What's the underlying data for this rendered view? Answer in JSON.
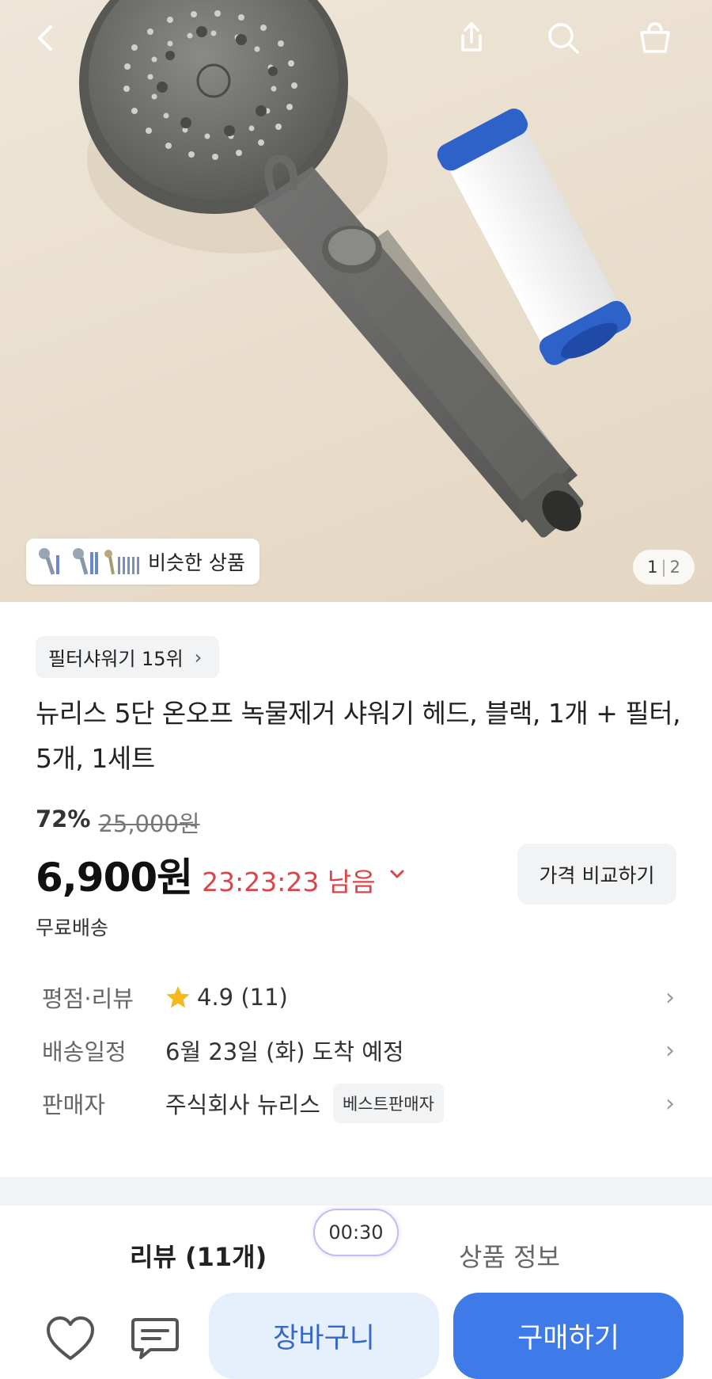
{
  "header": {
    "back_icon": "chevron-left-icon",
    "share_icon": "share-icon",
    "search_icon": "search-icon",
    "cart_icon": "shopping-bag-icon"
  },
  "gallery": {
    "similar_label": "비슷한 상품",
    "page_current": "1",
    "page_total": "2"
  },
  "product": {
    "rank_label": "필터샤워기 15위",
    "title": "뉴리스 5단 온오프 녹물제거 샤워기 헤드, 블랙, 1개 + 필터, 5개, 1세트",
    "discount_percent": "72%",
    "original_price": "25,000원",
    "price": "6,900원",
    "countdown": "23:23:23 남음",
    "compare_label": "가격 비교하기",
    "shipping": "무료배송"
  },
  "info": {
    "rating_key": "평점·리뷰",
    "rating_value": "4.9 (11)",
    "delivery_key": "배송일정",
    "delivery_value": "6월 23일 (화) 도착 예정",
    "seller_key": "판매자",
    "seller_value": "주식회사 뉴리스",
    "seller_badge": "베스트판매자"
  },
  "tabs": {
    "review": "리뷰 (11개)",
    "product_info": "상품 정보",
    "timer": "00:30"
  },
  "bottom": {
    "cart_label": "장바구니",
    "buy_label": "구매하기"
  },
  "colors": {
    "accent_blue": "#3f7be8",
    "countdown_red": "#d9454a",
    "star": "#f5b81d"
  }
}
